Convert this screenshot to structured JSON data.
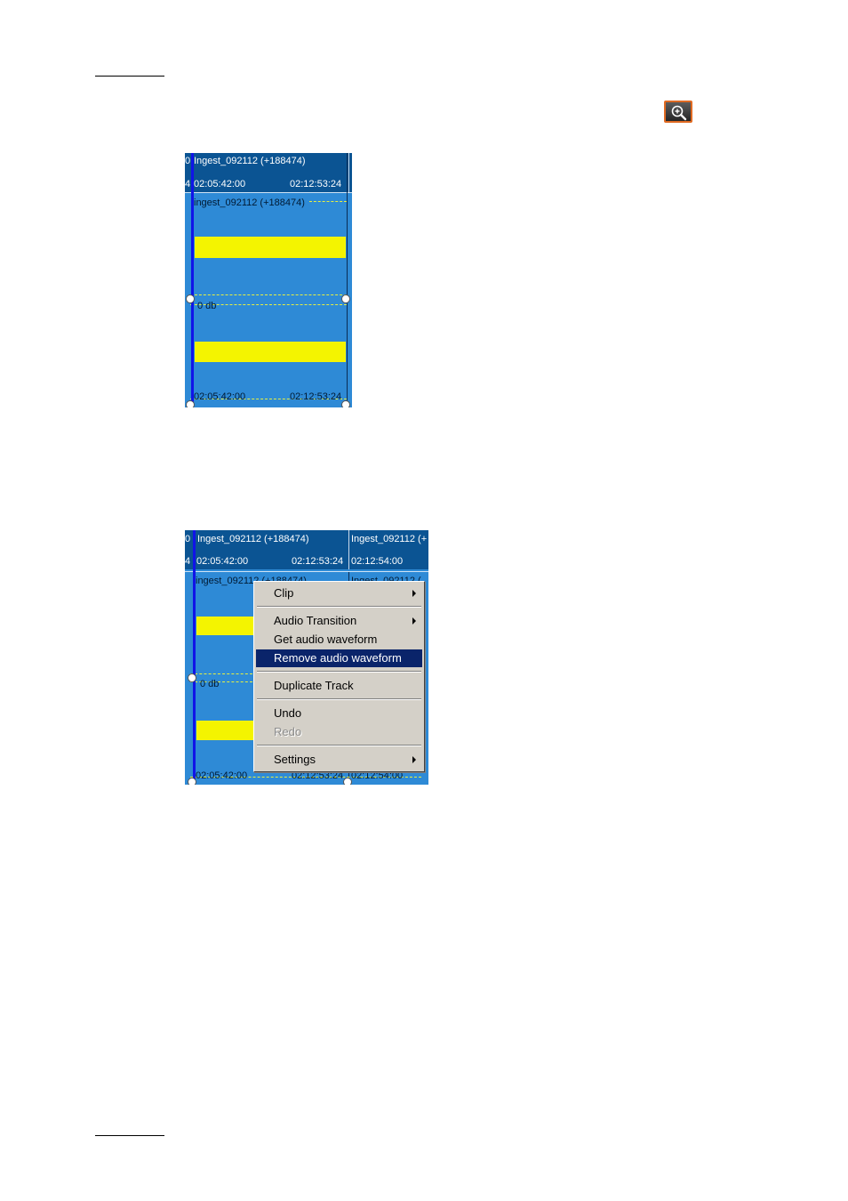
{
  "page": {
    "zoom_icon": "zoom-in-magnifier-icon",
    "accent_color": "#e06a22"
  },
  "figure1": {
    "clip_header": "Ingest_092112 (+188474)",
    "tc_in": "02:05:42:00",
    "tc_out": "02:12:53:24",
    "clip_label": "ingest_092112 (+188474)",
    "level_label": "0 db",
    "bottom_tc_in": "02:05:42:00",
    "bottom_tc_out": "02:12:53:24",
    "waveform_color": "#f4f400",
    "track_color": "#2e8ad6"
  },
  "figure2": {
    "clip_header": "Ingest_092112 (+188474)",
    "next_clip_header": "Ingest_092112 (+",
    "tc_in": "02:05:42:00",
    "tc_out": "02:12:53:24",
    "next_tc_in": "02:12:54:00",
    "clip_label": "ingest_092112 (+188474)",
    "next_clip_label": "Ingest_092112 (",
    "level_label": "0 db",
    "bottom_tc_in": "02:05:42:00",
    "bottom_tc_out": "02:12:53:24",
    "bottom_next_tc": "02:12:54:00",
    "context_menu": {
      "clip": "Clip",
      "audio_transition": "Audio Transition",
      "get_waveform": "Get audio waveform",
      "remove_waveform": "Remove audio waveform",
      "duplicate_track": "Duplicate Track",
      "undo": "Undo",
      "redo": "Redo",
      "settings": "Settings",
      "selected_color": "#0a246a"
    }
  }
}
